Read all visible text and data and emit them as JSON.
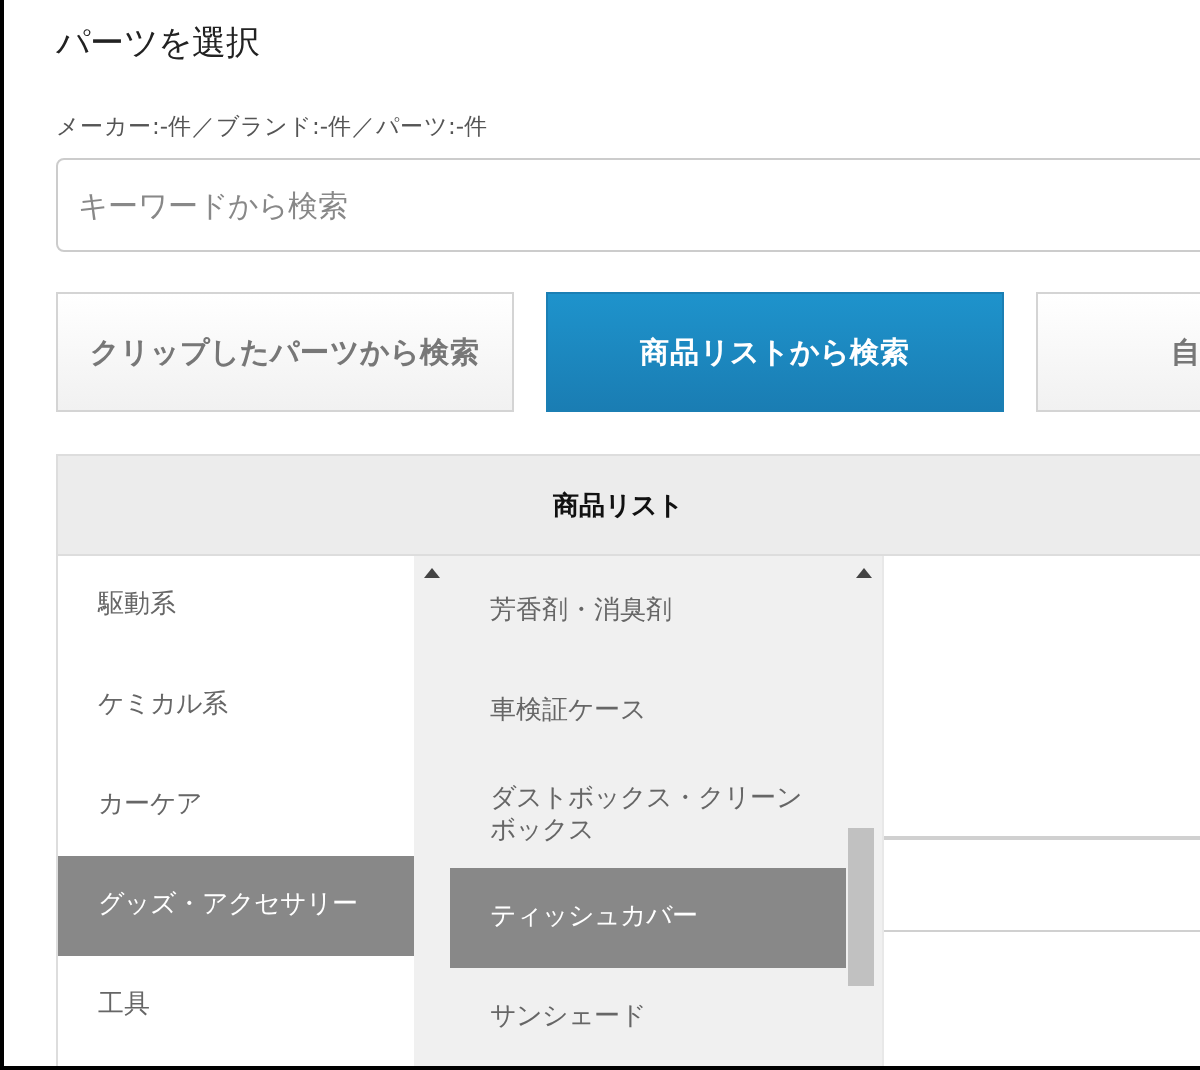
{
  "title": "パーツを選択",
  "counts": "メーカー:-件／ブランド:-件／パーツ:-件",
  "search": {
    "placeholder": "キーワードから検索"
  },
  "modes": [
    {
      "label": "クリップしたパーツから検索",
      "selected": false
    },
    {
      "label": "商品リストから検索",
      "selected": true
    },
    {
      "label": "自",
      "selected": false
    }
  ],
  "panel": {
    "title": "商品リスト",
    "categories": [
      {
        "label": "駆動系",
        "selected": false
      },
      {
        "label": "ケミカル系",
        "selected": false
      },
      {
        "label": "カーケア",
        "selected": false
      },
      {
        "label": "グッズ・アクセサリー",
        "selected": true
      },
      {
        "label": "工具",
        "selected": false
      }
    ],
    "subcategories": [
      {
        "label": "芳香剤・消臭剤",
        "selected": false
      },
      {
        "label": "車検証ケース",
        "selected": false
      },
      {
        "label": "ダストボックス・クリーンボックス",
        "selected": false
      },
      {
        "label": "ティッシュカバー",
        "selected": true
      },
      {
        "label": "サンシェード",
        "selected": false
      }
    ]
  }
}
